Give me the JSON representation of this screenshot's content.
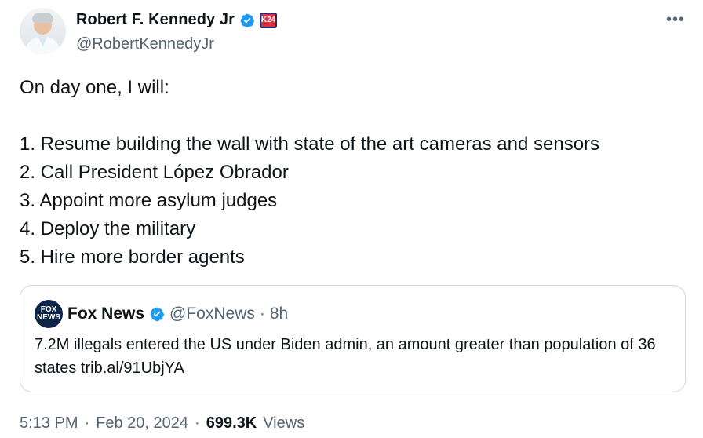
{
  "author": {
    "name": "Robert F. Kennedy Jr",
    "handle": "@RobertKennedyJr",
    "badge_text": "K24",
    "verified_color": "#1d9bf0"
  },
  "tweet": {
    "text": "On day one, I will:\n\n1. Resume building the wall with state of the art cameras and sensors\n2. Call President López Obrador\n3. Appoint more asylum judges\n4. Deploy the military\n5. Hire more border agents",
    "time": "5:13 PM",
    "date": "Feb 20, 2024",
    "views_count": "699.3K",
    "views_label": "Views"
  },
  "quoted": {
    "name": "Fox News",
    "handle": "@FoxNews",
    "time": "8h",
    "text": "7.2M illegals entered the US under Biden admin, an amount greater than population of 36 states trib.al/91UbjYA",
    "logo_line1": "FOX",
    "logo_line2": "NEWS"
  },
  "menu": {
    "more_icon": "more-icon"
  },
  "separators": {
    "dot": "·"
  }
}
